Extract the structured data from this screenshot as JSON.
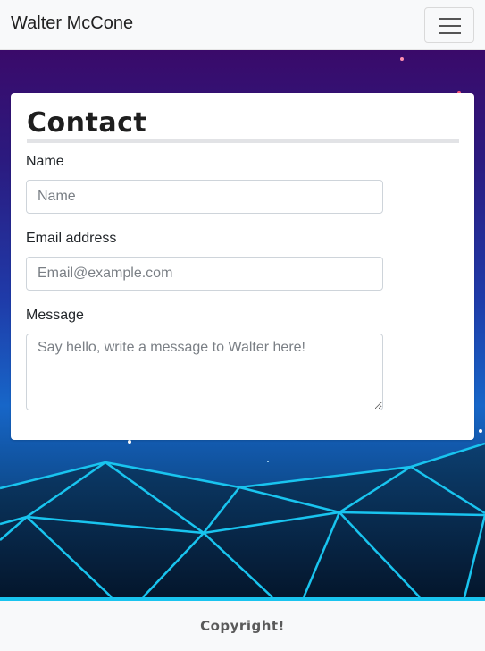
{
  "navbar": {
    "brand": "Walter McCone",
    "toggle_icon": "hamburger-menu-icon"
  },
  "hero": {
    "background_colors": [
      "#3a0a6a",
      "#1f3aa8",
      "#1766c8",
      "#062046"
    ],
    "grid_line_color": "#19c4ef"
  },
  "contact": {
    "title": "Contact",
    "fields": {
      "name": {
        "label": "Name",
        "placeholder": "Name",
        "value": ""
      },
      "email": {
        "label": "Email address",
        "placeholder": "Email@example.com",
        "value": ""
      },
      "message": {
        "label": "Message",
        "placeholder": "Say hello, write a message to Walter here!",
        "value": ""
      }
    }
  },
  "footer": {
    "copyright": "Copyright!"
  }
}
